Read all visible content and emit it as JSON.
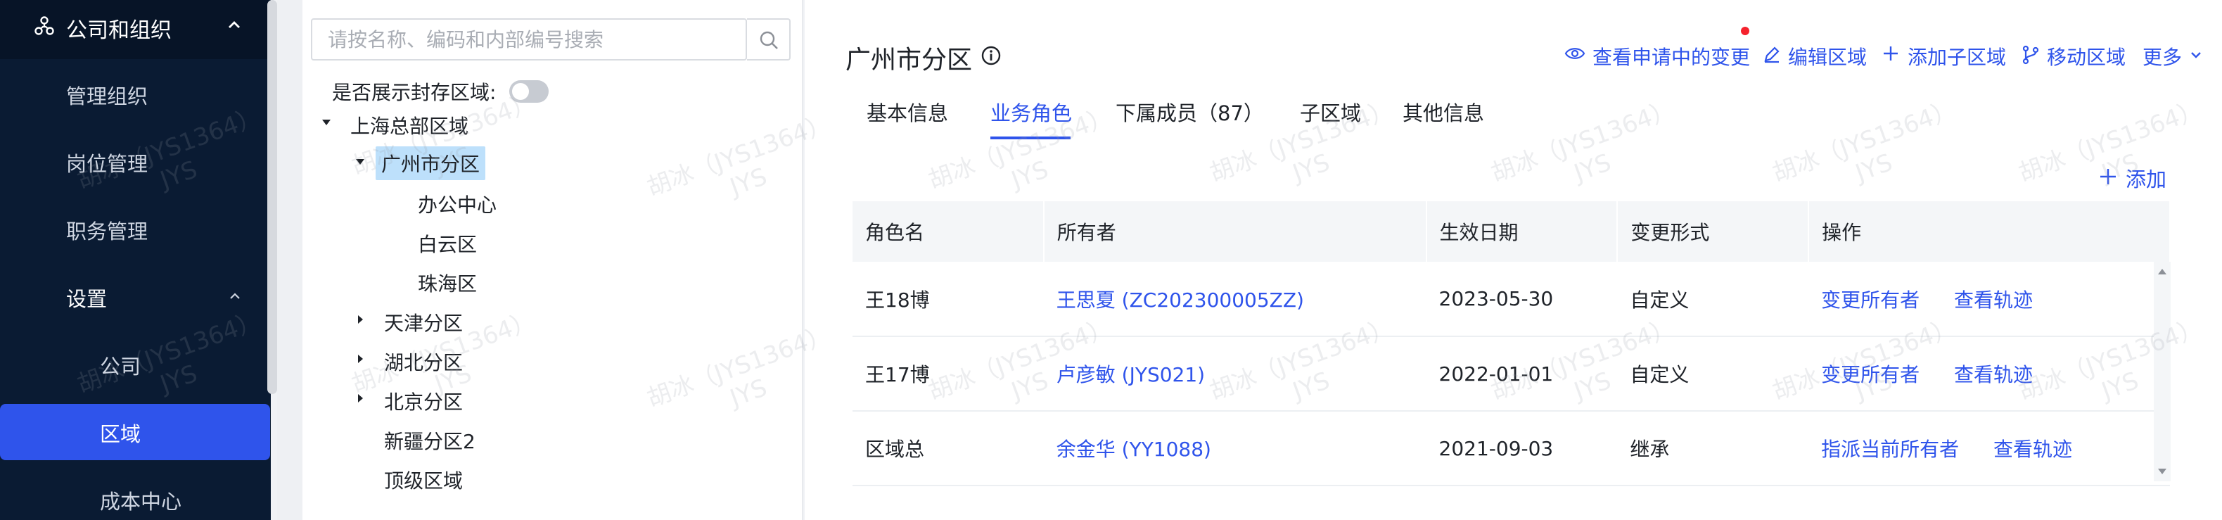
{
  "sidebar": {
    "header": {
      "label": "公司和组织",
      "icon": "org-icon"
    },
    "items": [
      {
        "label": "管理组织"
      },
      {
        "label": "岗位管理"
      },
      {
        "label": "职务管理"
      },
      {
        "label": "设置"
      },
      {
        "label": "公司"
      },
      {
        "label": "区域"
      },
      {
        "label": "成本中心"
      }
    ]
  },
  "tree": {
    "search_placeholder": "请按名称、编码和内部编号搜索",
    "archive_label": "是否展示封存区域:",
    "nodes": [
      {
        "label": "上海总部区域"
      },
      {
        "label": "广州市分区"
      },
      {
        "label": "办公中心"
      },
      {
        "label": "白云区"
      },
      {
        "label": "珠海区"
      },
      {
        "label": "天津分区"
      },
      {
        "label": "湖北分区"
      },
      {
        "label": "北京分区"
      },
      {
        "label": "新疆分区2"
      },
      {
        "label": "顶级区域"
      }
    ]
  },
  "main": {
    "title": "广州市分区",
    "actions": {
      "view_pending": "查看申请中的变更",
      "edit": "编辑区域",
      "add_child": "添加子区域",
      "move": "移动区域",
      "more": "更多"
    },
    "tabs": [
      "基本信息",
      "业务角色",
      "下属成员（87）",
      "子区域",
      "其他信息"
    ],
    "active_tab": "业务角色",
    "add_label": "添加",
    "table": {
      "headers": [
        "角色名",
        "所有者",
        "生效日期",
        "变更形式",
        "操作"
      ],
      "rows": [
        {
          "role": "王18博",
          "owner": "王思夏 (ZC202300005ZZ)",
          "date": "2023-05-30",
          "type": "自定义",
          "op1": "变更所有者",
          "op2": "查看轨迹"
        },
        {
          "role": "王17博",
          "owner": "卢彦敏 (JYS021)",
          "date": "2022-01-01",
          "type": "自定义",
          "op1": "变更所有者",
          "op2": "查看轨迹"
        },
        {
          "role": "区域总",
          "owner": "余金华 (YY1088)",
          "date": "2021-09-03",
          "type": "继承",
          "op1": "指派当前所有者",
          "op2": "查看轨迹"
        }
      ]
    }
  },
  "watermark": {
    "line1": "胡冰（JYS1364）",
    "line2": "JYS"
  },
  "colors": {
    "accent": "#2f54eb",
    "sidebar": "#0a1b33",
    "selected_node": "#bde0fb"
  }
}
